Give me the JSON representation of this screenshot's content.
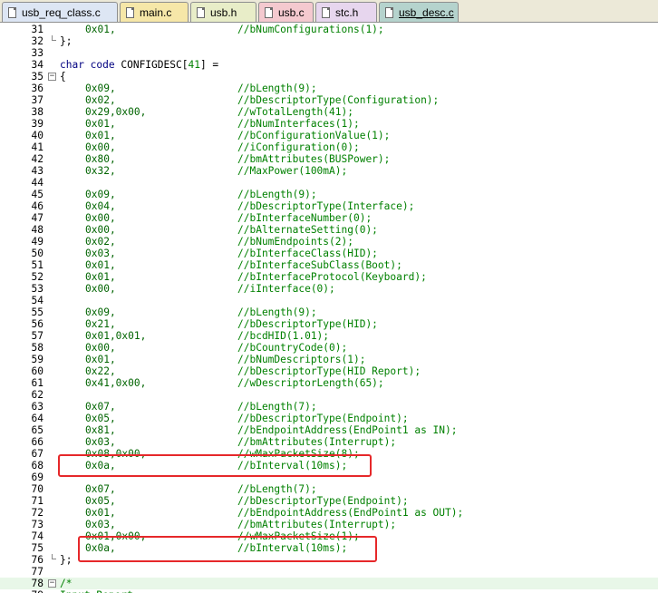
{
  "tabs": [
    {
      "label": "usb_req_class.c",
      "active": false,
      "color": "#dde6f4"
    },
    {
      "label": "main.c",
      "active": false,
      "color": "#f6e7a8"
    },
    {
      "label": "usb.h",
      "active": false,
      "color": "#e8edc8"
    },
    {
      "label": "usb.c",
      "active": false,
      "color": "#f4c9cf"
    },
    {
      "label": "stc.h",
      "active": false,
      "color": "#e7d6ee"
    },
    {
      "label": "usb_desc.c",
      "active": true,
      "color": "#b5d3cd"
    }
  ],
  "lines": [
    {
      "n": "31",
      "v": "0x01,",
      "c": "//bNumConfigurations(1);"
    },
    {
      "n": "32",
      "code": "};",
      "fold": "end"
    },
    {
      "n": "33"
    },
    {
      "n": "34",
      "decl": true
    },
    {
      "n": "35",
      "code": "{",
      "fold": "start"
    },
    {
      "n": "36",
      "v": "0x09,",
      "c": "//bLength(9);"
    },
    {
      "n": "37",
      "v": "0x02,",
      "c": "//bDescriptorType(Configuration);"
    },
    {
      "n": "38",
      "v": "0x29,0x00,",
      "c": "//wTotalLength(41);"
    },
    {
      "n": "39",
      "v": "0x01,",
      "c": "//bNumInterfaces(1);"
    },
    {
      "n": "40",
      "v": "0x01,",
      "c": "//bConfigurationValue(1);"
    },
    {
      "n": "41",
      "v": "0x00,",
      "c": "//iConfiguration(0);"
    },
    {
      "n": "42",
      "v": "0x80,",
      "c": "//bmAttributes(BUSPower);"
    },
    {
      "n": "43",
      "v": "0x32,",
      "c": "//MaxPower(100mA);"
    },
    {
      "n": "44"
    },
    {
      "n": "45",
      "v": "0x09,",
      "c": "//bLength(9);"
    },
    {
      "n": "46",
      "v": "0x04,",
      "c": "//bDescriptorType(Interface);"
    },
    {
      "n": "47",
      "v": "0x00,",
      "c": "//bInterfaceNumber(0);"
    },
    {
      "n": "48",
      "v": "0x00,",
      "c": "//bAlternateSetting(0);"
    },
    {
      "n": "49",
      "v": "0x02,",
      "c": "//bNumEndpoints(2);"
    },
    {
      "n": "50",
      "v": "0x03,",
      "c": "//bInterfaceClass(HID);"
    },
    {
      "n": "51",
      "v": "0x01,",
      "c": "//bInterfaceSubClass(Boot);"
    },
    {
      "n": "52",
      "v": "0x01,",
      "c": "//bInterfaceProtocol(Keyboard);"
    },
    {
      "n": "53",
      "v": "0x00,",
      "c": "//iInterface(0);"
    },
    {
      "n": "54"
    },
    {
      "n": "55",
      "v": "0x09,",
      "c": "//bLength(9);"
    },
    {
      "n": "56",
      "v": "0x21,",
      "c": "//bDescriptorType(HID);"
    },
    {
      "n": "57",
      "v": "0x01,0x01,",
      "c": "//bcdHID(1.01);"
    },
    {
      "n": "58",
      "v": "0x00,",
      "c": "//bCountryCode(0);"
    },
    {
      "n": "59",
      "v": "0x01,",
      "c": "//bNumDescriptors(1);"
    },
    {
      "n": "60",
      "v": "0x22,",
      "c": "//bDescriptorType(HID Report);"
    },
    {
      "n": "61",
      "v": "0x41,0x00,",
      "c": "//wDescriptorLength(65);"
    },
    {
      "n": "62"
    },
    {
      "n": "63",
      "v": "0x07,",
      "c": "//bLength(7);"
    },
    {
      "n": "64",
      "v": "0x05,",
      "c": "//bDescriptorType(Endpoint);"
    },
    {
      "n": "65",
      "v": "0x81,",
      "c": "//bEndpointAddress(EndPoint1 as IN);"
    },
    {
      "n": "66",
      "v": "0x03,",
      "c": "//bmAttributes(Interrupt);"
    },
    {
      "n": "67",
      "v": "0x08,0x00,",
      "c": "//wMaxPacketSize(8);"
    },
    {
      "n": "68",
      "v": "0x0a,",
      "c": "//bInterval(10ms);"
    },
    {
      "n": "69"
    },
    {
      "n": "70",
      "v": "0x07,",
      "c": "//bLength(7);"
    },
    {
      "n": "71",
      "v": "0x05,",
      "c": "//bDescriptorType(Endpoint);"
    },
    {
      "n": "72",
      "v": "0x01,",
      "c": "//bEndpointAddress(EndPoint1 as OUT);"
    },
    {
      "n": "73",
      "v": "0x03,",
      "c": "//bmAttributes(Interrupt);"
    },
    {
      "n": "74",
      "v": "0x01,0x00,",
      "c": "//wMaxPacketSize(1);"
    },
    {
      "n": "75",
      "v": "0x0a,",
      "c": "//bInterval(10ms);"
    },
    {
      "n": "76",
      "code": "};",
      "fold": "end"
    },
    {
      "n": "77"
    },
    {
      "n": "78",
      "code": "/*",
      "fold": "start",
      "hl": true
    },
    {
      "n": "79",
      "code": "Input Report"
    }
  ],
  "decl": {
    "kw": "char code",
    "name": " CONFIGDESC[",
    "size": "41",
    "end": "] ="
  },
  "highlight_color": "#e6282a"
}
